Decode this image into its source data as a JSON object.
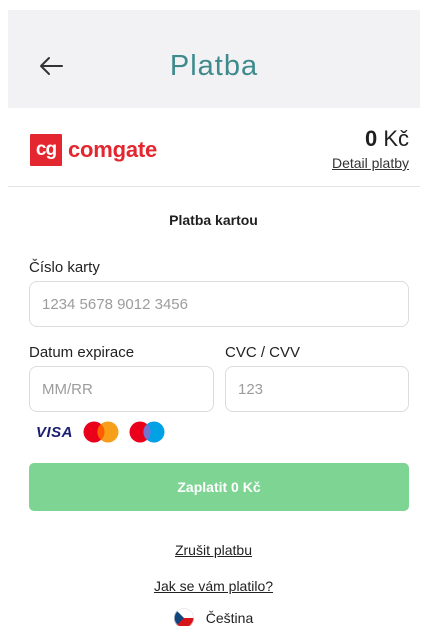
{
  "header": {
    "title": "Platba",
    "back_icon": "arrow-left-icon"
  },
  "merchant": {
    "logo_mark": "cg",
    "logo_word": "comgate",
    "brand_color": "#e3262f"
  },
  "summary": {
    "amount_value": "0",
    "amount_currency": "Kč",
    "detail_link": "Detail platby"
  },
  "form": {
    "section_title": "Platba kartou",
    "card_number_label": "Číslo karty",
    "card_number_placeholder": "1234 5678 9012 3456",
    "expiry_label": "Datum expirace",
    "expiry_placeholder": "MM/RR",
    "cvc_label": "CVC / CVV",
    "cvc_placeholder": "123",
    "accepted_cards": [
      "visa-logo",
      "mastercard-logo",
      "maestro-logo"
    ],
    "visa_text": "VISA"
  },
  "actions": {
    "pay_label": "Zaplatit 0 Kč",
    "pay_color": "#7ed492",
    "cancel_label": "Zrušit platbu",
    "feedback_label": "Jak se vám platilo?"
  },
  "language": {
    "label": "Čeština",
    "flag_icon": "czech-flag-icon"
  },
  "colors": {
    "title": "#3e8a8c",
    "header_bg": "#f2f2f4"
  }
}
